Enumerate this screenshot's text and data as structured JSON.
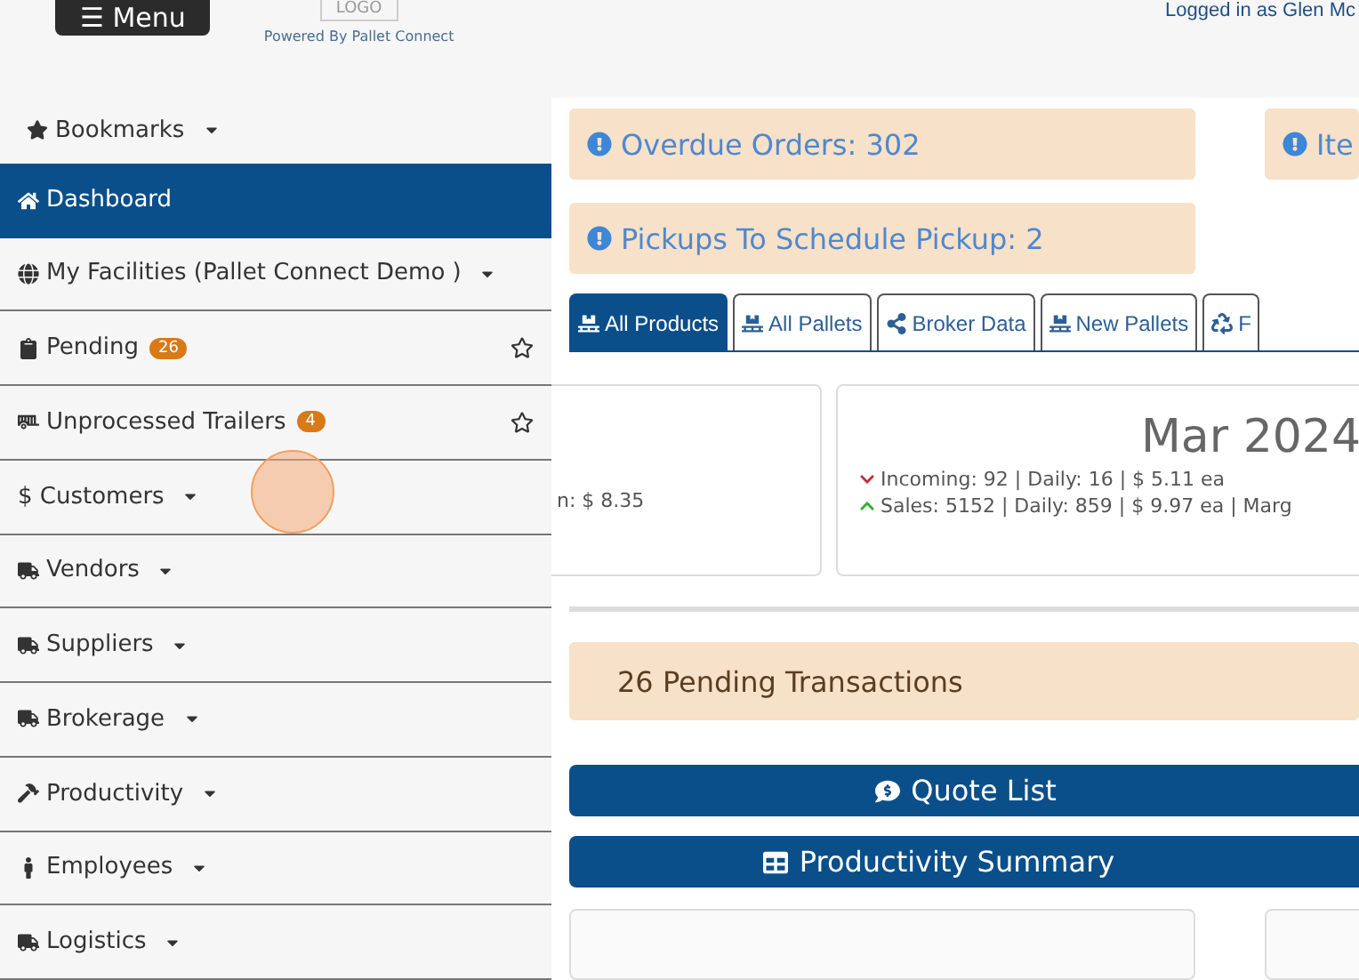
{
  "header": {
    "menu_button": "☰ Menu",
    "logo": "LOGO",
    "powered_by": "Powered By Pallet Connect",
    "user": "Logged in as Glen Mc"
  },
  "sidebar": {
    "items": [
      {
        "label": "Bookmarks",
        "kind": "star",
        "dropdown": true,
        "selected": false
      },
      {
        "label": "Dashboard",
        "kind": "home",
        "dropdown": false,
        "selected": true
      },
      {
        "label": "My Facilities (Pallet Connect Demo )",
        "kind": "globe",
        "dropdown": true,
        "selected": false
      },
      {
        "label": "Pending",
        "kind": "clipboard",
        "badge": "26",
        "bookmark": true,
        "dropdown": false,
        "selected": false
      },
      {
        "label": "Unprocessed Trailers",
        "kind": "trailer",
        "badge": "4",
        "bookmark": true,
        "dropdown": false,
        "selected": false
      },
      {
        "label": "$ Customers",
        "kind": "plain",
        "dropdown": true,
        "selected": false
      },
      {
        "label": "Vendors",
        "kind": "truck",
        "dropdown": true,
        "selected": false
      },
      {
        "label": "Suppliers",
        "kind": "truck",
        "dropdown": true,
        "selected": false
      },
      {
        "label": "Brokerage",
        "kind": "truck",
        "dropdown": true,
        "selected": false
      },
      {
        "label": "Productivity",
        "kind": "hammer",
        "dropdown": true,
        "selected": false
      },
      {
        "label": "Employees",
        "kind": "person",
        "dropdown": true,
        "selected": false
      },
      {
        "label": "Logistics",
        "kind": "truck",
        "dropdown": true,
        "selected": false
      }
    ]
  },
  "alerts": [
    {
      "text": "Overdue Orders: 302"
    },
    {
      "text": "Ite"
    },
    {
      "text": "Pickups To Schedule Pickup: 2"
    }
  ],
  "tabs": [
    {
      "label": "All Products",
      "kind": "pallet",
      "selected": true
    },
    {
      "label": "All Pallets",
      "kind": "pallet",
      "selected": false
    },
    {
      "label": "Broker Data",
      "kind": "share",
      "selected": false
    },
    {
      "label": "New Pallets",
      "kind": "pallet",
      "selected": false
    },
    {
      "label": "F",
      "kind": "recycle",
      "selected": false
    }
  ],
  "stat_cards": [
    {
      "lines": [
        {
          "kind": "plain",
          "text": "n: $ 8.35"
        }
      ]
    },
    {
      "title": "Mar 2024",
      "lines": [
        {
          "kind": "down",
          "text": "Incoming: 92 | Daily: 16 | $ 5.11 ea"
        },
        {
          "kind": "up",
          "text": "Sales: 5152 | Daily: 859 | $ 9.97 ea | Marg"
        }
      ]
    }
  ],
  "pending_notice": "26 Pending Transactions",
  "action_buttons": [
    {
      "label": "Quote List",
      "kind": "quote"
    },
    {
      "label": "Productivity Summary",
      "kind": "table"
    }
  ]
}
